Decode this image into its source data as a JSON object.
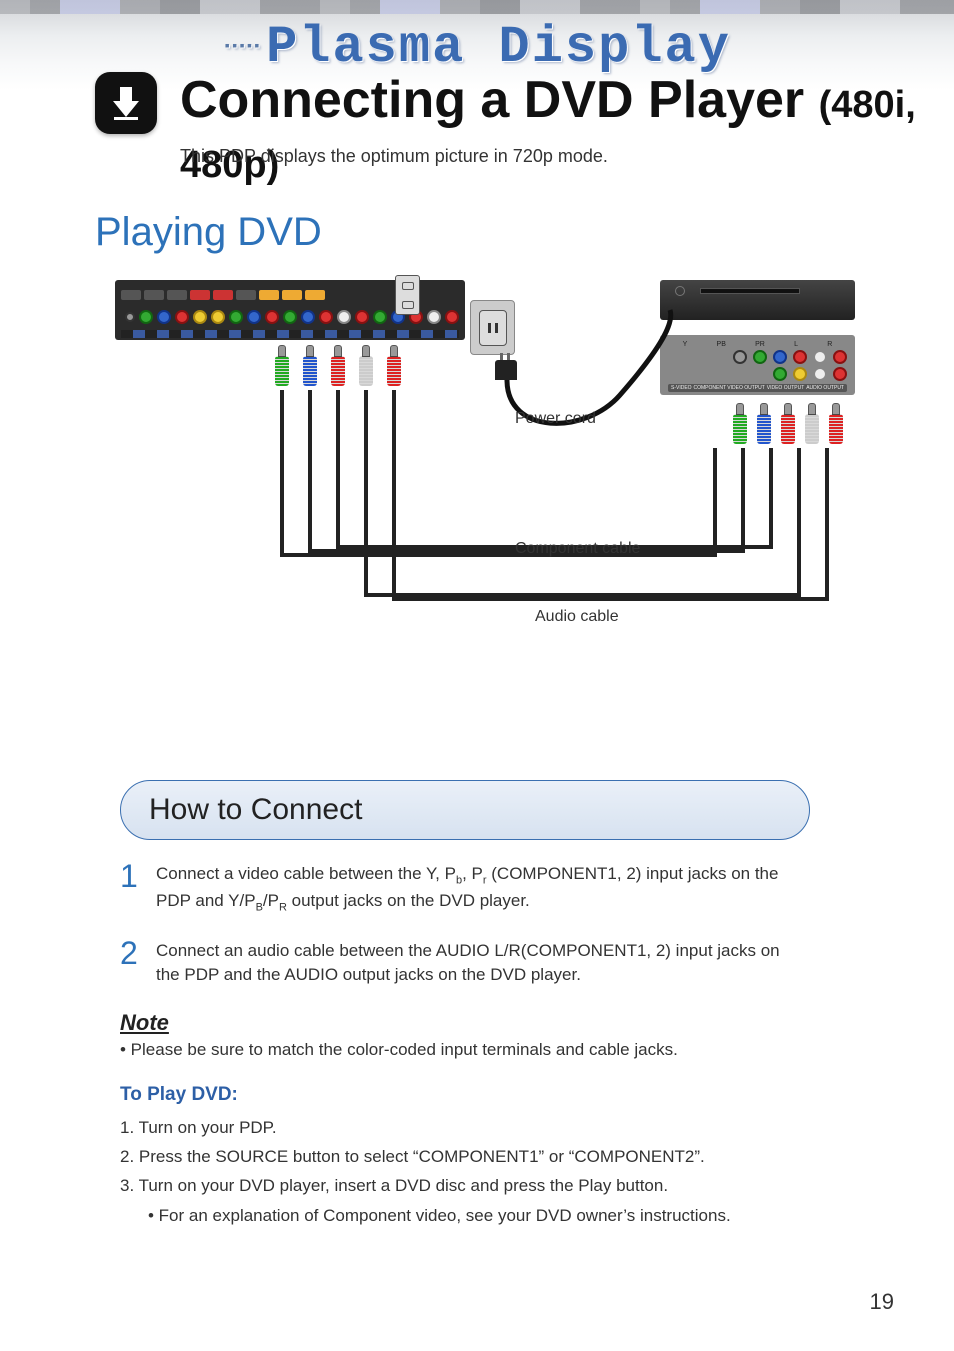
{
  "header": {
    "brand": "Plasma Display",
    "title_main": "Connecting a DVD Player",
    "title_sub": "(480i, 480p)",
    "intro": "This PDP displays the optimum picture in 720p mode."
  },
  "section": {
    "playing": "Playing DVD",
    "howto": "How to Connect"
  },
  "diagram": {
    "power_cord": "Power cord",
    "component_cable": "Component cable",
    "audio_cable": "Audio cable",
    "dvd_labels": {
      "y": "Y",
      "pb": "PB",
      "pr": "PR",
      "l": "L",
      "r": "R"
    },
    "dvd_bottom": {
      "svideo": "S-VIDEO",
      "comp": "COMPONENT VIDEO OUTPUT",
      "vid": "VIDEO OUTPUT",
      "aud": "AUDIO OUTPUT"
    }
  },
  "steps": {
    "s1_num": "1",
    "s1": "Connect a video cable between the Y, Pb, Pr (COMPONENT1, 2) input jacks on the PDP and Y/PB/PR output jacks on the DVD player.",
    "s2_num": "2",
    "s2": "Connect an audio cable between the AUDIO L/R(COMPONENT1, 2) input jacks on the PDP and the AUDIO output jacks on the DVD player."
  },
  "note": {
    "hdr": "Note",
    "bullet": "•  Please be sure to match the color-coded input terminals and cable jacks."
  },
  "play": {
    "hdr": "To Play DVD:",
    "i1": "1.  Turn on your PDP.",
    "i2": "2.  Press the SOURCE button to select “COMPONENT1” or “COMPONENT2”.",
    "i3": "3.  Turn on your DVD player, insert a DVD disc and press the Play button.",
    "i3b": "• For an explanation of Component video, see your DVD owner’s instructions."
  },
  "page_number": "19"
}
